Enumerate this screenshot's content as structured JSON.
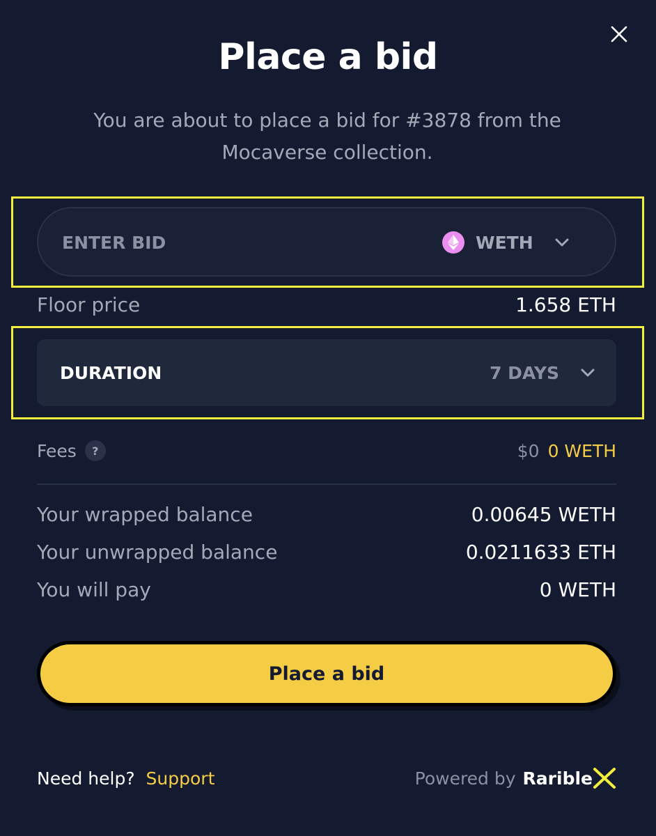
{
  "modal": {
    "title": "Place a bid",
    "subtitle": "You are about to place a bid for #3878 from the Mocaverse collection."
  },
  "bid_input": {
    "placeholder": "ENTER BID",
    "value": "",
    "currency": "WETH",
    "currency_icon": "ethereum-icon"
  },
  "floor_price": {
    "label": "Floor price",
    "value": "1.658 ETH"
  },
  "duration": {
    "label": "DURATION",
    "value": "7 DAYS"
  },
  "fees": {
    "label": "Fees",
    "help_glyph": "?",
    "usd": "$0",
    "weth": "0 WETH"
  },
  "balances": [
    {
      "label": "Your wrapped balance",
      "value": "0.00645 WETH"
    },
    {
      "label": "Your unwrapped balance",
      "value": "0.0211633 ETH"
    },
    {
      "label": "You will pay",
      "value": "0 WETH"
    }
  ],
  "cta": {
    "label": "Place a bid"
  },
  "footer": {
    "help_text": "Need help?",
    "support_label": "Support",
    "powered_by": "Powered by",
    "brand": "Rarible",
    "brand_mark": "X"
  },
  "colors": {
    "background": "#141b31",
    "accent": "#f5cd45",
    "highlight": "#f3ee3b",
    "eth_badge": "#ea8ff0"
  }
}
